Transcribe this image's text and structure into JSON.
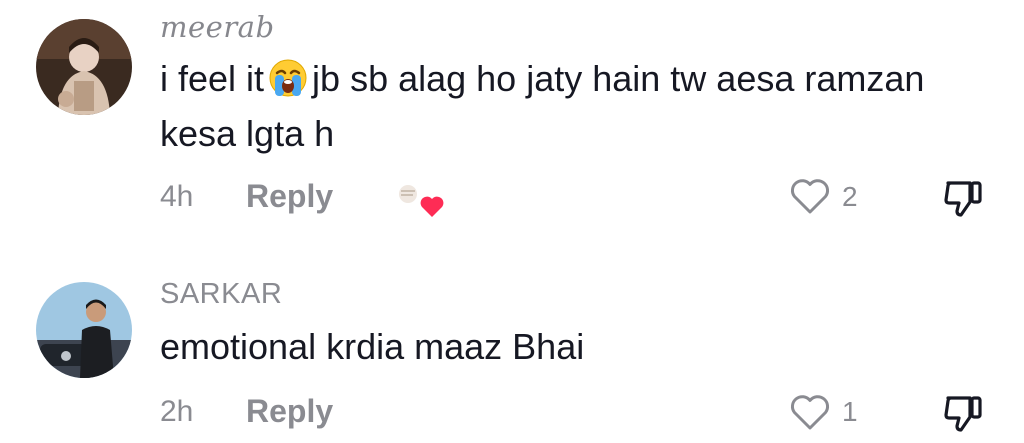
{
  "comments": [
    {
      "username": "meerab",
      "text_before_emoji": "i feel it",
      "emoji": "loudly-crying-face-emoji",
      "text_after_emoji": "jb sb alag ho jaty hain tw aesa ramzan kesa lgta h",
      "time": "4h",
      "reply_label": "Reply",
      "liked_by_creator": true,
      "like_count": "2"
    },
    {
      "username": "SARKAR",
      "text": "emotional krdia maaz Bhai",
      "time": "2h",
      "reply_label": "Reply",
      "liked_by_creator": false,
      "like_count": "1"
    }
  ],
  "colors": {
    "secondary_text": "#8a8b91",
    "primary_text": "#161823",
    "heart_red": "#fe2c55"
  }
}
